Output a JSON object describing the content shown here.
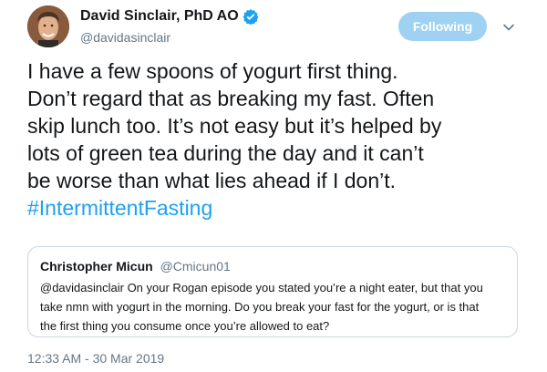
{
  "author": {
    "display_name": "David Sinclair, PhD AO",
    "handle": "@davidasinclair",
    "verified": true
  },
  "follow_button": {
    "label": "Following",
    "color": "#9fd1f2"
  },
  "menu": {
    "icon": "chevron-down-icon"
  },
  "tweet": {
    "lines": [
      "I have a few spoons of yogurt first thing.",
      "Don’t regard that as breaking my fast. Often",
      "skip lunch too. It’s not easy but it’s helped by",
      "lots of green tea during the day and it can’t",
      "be worse than what lies ahead if I don’t."
    ],
    "hashtag": "#IntermittentFasting",
    "hashtag_color": "#1da1f2"
  },
  "quoted_tweet": {
    "name": "Christopher Micun",
    "handle": "@Cmicun01",
    "lines": [
      "@davidasinclair On your Rogan episode you stated you’re a night eater, but that you",
      "take nmn with yogurt in the morning. Do you break your fast for the yogurt, or is that",
      "the first thing you consume once you’re allowed to eat?"
    ]
  },
  "timestamp": "12:33 AM - 30 Mar 2019"
}
